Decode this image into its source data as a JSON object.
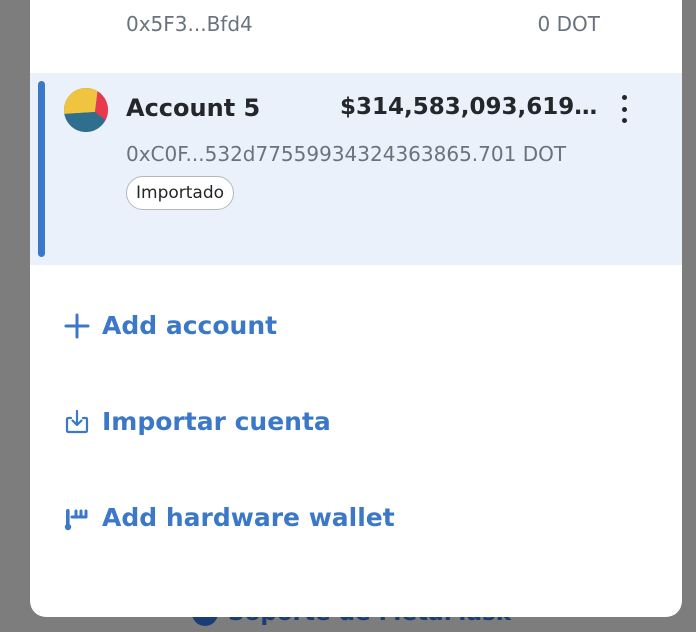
{
  "backdrop": {
    "support_link": "Soporte de MetaMask"
  },
  "accounts": [
    {
      "address": "0x5F3...Bfd4",
      "balance": "0 DOT"
    },
    {
      "name": "Account 5",
      "fiat_balance": "$314,583,093,619,6...",
      "subtitle": "0xC0F...532d77559934324363865.701 DOT",
      "tag": "Importado",
      "selected": true
    }
  ],
  "actions": {
    "add_account": "Add account",
    "import_account": "Importar cuenta",
    "add_hardware_wallet": "Add hardware wallet"
  },
  "colors": {
    "accent": "#3b78c7",
    "selected_bg": "#eaf1fa",
    "text_primary": "#24272a",
    "text_secondary": "#6a737d",
    "overlay": "#7d7d7d"
  },
  "icons": {
    "add": "plus-icon",
    "import": "import-icon",
    "hardware": "hardware-wallet-icon",
    "menu": "kebab-menu-icon"
  }
}
